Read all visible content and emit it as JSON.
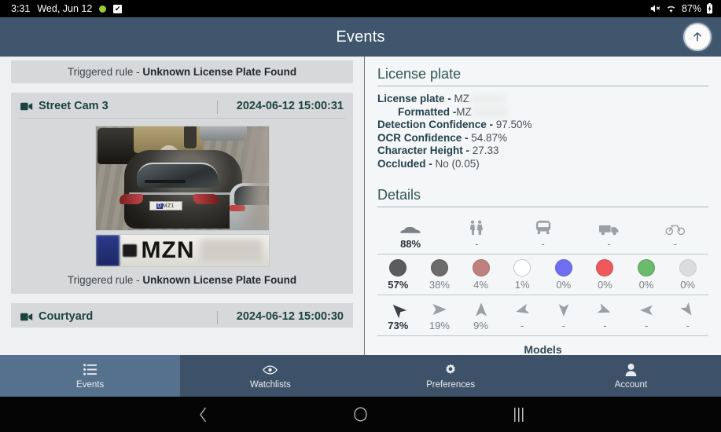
{
  "statusbar": {
    "time": "3:31",
    "date": "Wed, Jun 12",
    "green_dot_icon": "recording-dot-icon",
    "checkbox_icon": "checkbox-checked-icon",
    "mute_icon": "mute-icon",
    "wifi_icon": "wifi-icon",
    "battery_percent": "87%",
    "battery_icon": "battery-charging-icon"
  },
  "appbar": {
    "title": "Events",
    "up_button_icon": "arrow-up-icon"
  },
  "events": {
    "top_rule_banner": {
      "prefix": "Triggered rule - ",
      "rule": "Unknown License Plate Found"
    },
    "items": [
      {
        "camera": "Street Cam 3",
        "timestamp": "2024-06-12 15:00:31",
        "camera_icon": "video-camera-icon",
        "plate_text": "MZN",
        "rule_prefix": "Triggered rule - ",
        "rule": "Unknown License Plate Found"
      },
      {
        "camera": "Courtyard",
        "timestamp": "2024-06-12 15:00:30",
        "camera_icon": "video-camera-icon"
      }
    ]
  },
  "license_plate": {
    "section_title": "License plate",
    "rows": [
      {
        "label": "License plate - ",
        "value": "MZ",
        "redacted": true
      },
      {
        "label": "Formatted - ",
        "value": "MZ",
        "redacted": true,
        "indent": true
      },
      {
        "label": "Detection Confidence - ",
        "value": "97.50%"
      },
      {
        "label": "OCR Confidence - ",
        "value": "54.87%"
      },
      {
        "label": "Character Height - ",
        "value": "27.33"
      },
      {
        "label": "Occluded - ",
        "value": "No (0.05)"
      }
    ]
  },
  "details": {
    "section_title": "Details",
    "models_label": "Models",
    "vehicle_types": [
      {
        "icon": "car-icon",
        "value": "88%",
        "strong": true
      },
      {
        "icon": "pedestrian-icon",
        "value": "-",
        "strong": false
      },
      {
        "icon": "bus-icon",
        "value": "-",
        "strong": false
      },
      {
        "icon": "truck-icon",
        "value": "-",
        "strong": false
      },
      {
        "icon": "bicycle-icon",
        "value": "-",
        "strong": false
      }
    ],
    "colors": [
      {
        "icon": "color-dot-dark-gray",
        "color": "#5c5c5c",
        "value": "57%",
        "strong": true
      },
      {
        "icon": "color-dot-gray",
        "color": "#6b6b6b",
        "value": "38%",
        "strong": false
      },
      {
        "icon": "color-dot-red-muted",
        "color": "#c08080",
        "value": "4%",
        "strong": false
      },
      {
        "icon": "color-dot-white",
        "color": "#ffffff",
        "value": "1%",
        "strong": false
      },
      {
        "icon": "color-dot-blue",
        "color": "#6f6ff0",
        "value": "0%",
        "strong": false
      },
      {
        "icon": "color-dot-red",
        "color": "#f0595c",
        "value": "0%",
        "strong": false
      },
      {
        "icon": "color-dot-green",
        "color": "#6cba6c",
        "value": "0%",
        "strong": false
      },
      {
        "icon": "color-dot-light-gray",
        "color": "#dcdcdc",
        "value": "0%",
        "strong": false
      }
    ],
    "directions": [
      {
        "icon": "arrow-northwest-icon",
        "rotate": -45,
        "value": "73%",
        "strong": true
      },
      {
        "icon": "arrow-east-icon",
        "rotate": 90,
        "value": "19%",
        "strong": false
      },
      {
        "icon": "arrow-north-icon",
        "rotate": 0,
        "value": "9%",
        "strong": false
      },
      {
        "icon": "arrow-west-icon",
        "rotate": -100,
        "value": "-",
        "strong": false
      },
      {
        "icon": "arrow-south-icon",
        "rotate": 180,
        "value": "-",
        "strong": false
      },
      {
        "icon": "arrow-southeast-icon",
        "rotate": 115,
        "value": "-",
        "strong": false
      },
      {
        "icon": "arrow-west-icon-2",
        "rotate": -90,
        "value": "-",
        "strong": false
      },
      {
        "icon": "arrow-south-east-icon",
        "rotate": 150,
        "value": "-",
        "strong": false
      }
    ]
  },
  "tabbar": {
    "tabs": [
      {
        "label": "Events",
        "icon": "list-icon",
        "active": true
      },
      {
        "label": "Watchlists",
        "icon": "eye-icon",
        "active": false
      },
      {
        "label": "Preferences",
        "icon": "gear-icon",
        "active": false
      },
      {
        "label": "Account",
        "icon": "person-icon",
        "active": false
      }
    ]
  },
  "navbar": {
    "back_icon": "back-chevron-icon",
    "home_icon": "home-circle-icon",
    "recents_icon": "recents-bars-icon"
  }
}
